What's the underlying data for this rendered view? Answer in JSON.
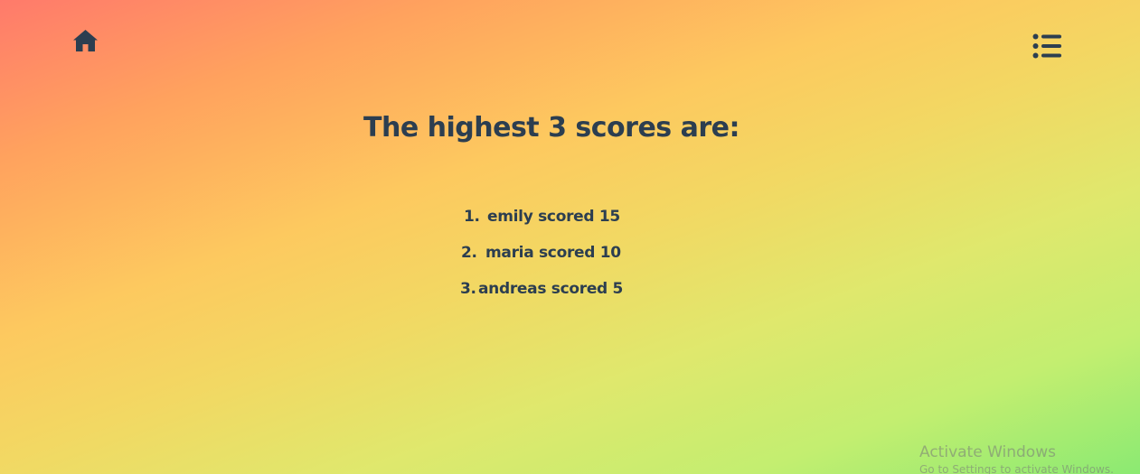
{
  "header": {
    "home_icon": "home-icon",
    "menu_icon": "list-menu-icon",
    "icon_color": "#2c3e50"
  },
  "main": {
    "title": "The highest 3 scores are:",
    "scores": [
      {
        "number": "1.",
        "text": "emily scored 15"
      },
      {
        "number": "2.",
        "text": "maria scored 10"
      },
      {
        "number": "3.",
        "text": "andreas scored 5"
      }
    ]
  },
  "watermark": {
    "title": "Activate Windows",
    "subtitle": "Go to Settings to activate Windows."
  }
}
